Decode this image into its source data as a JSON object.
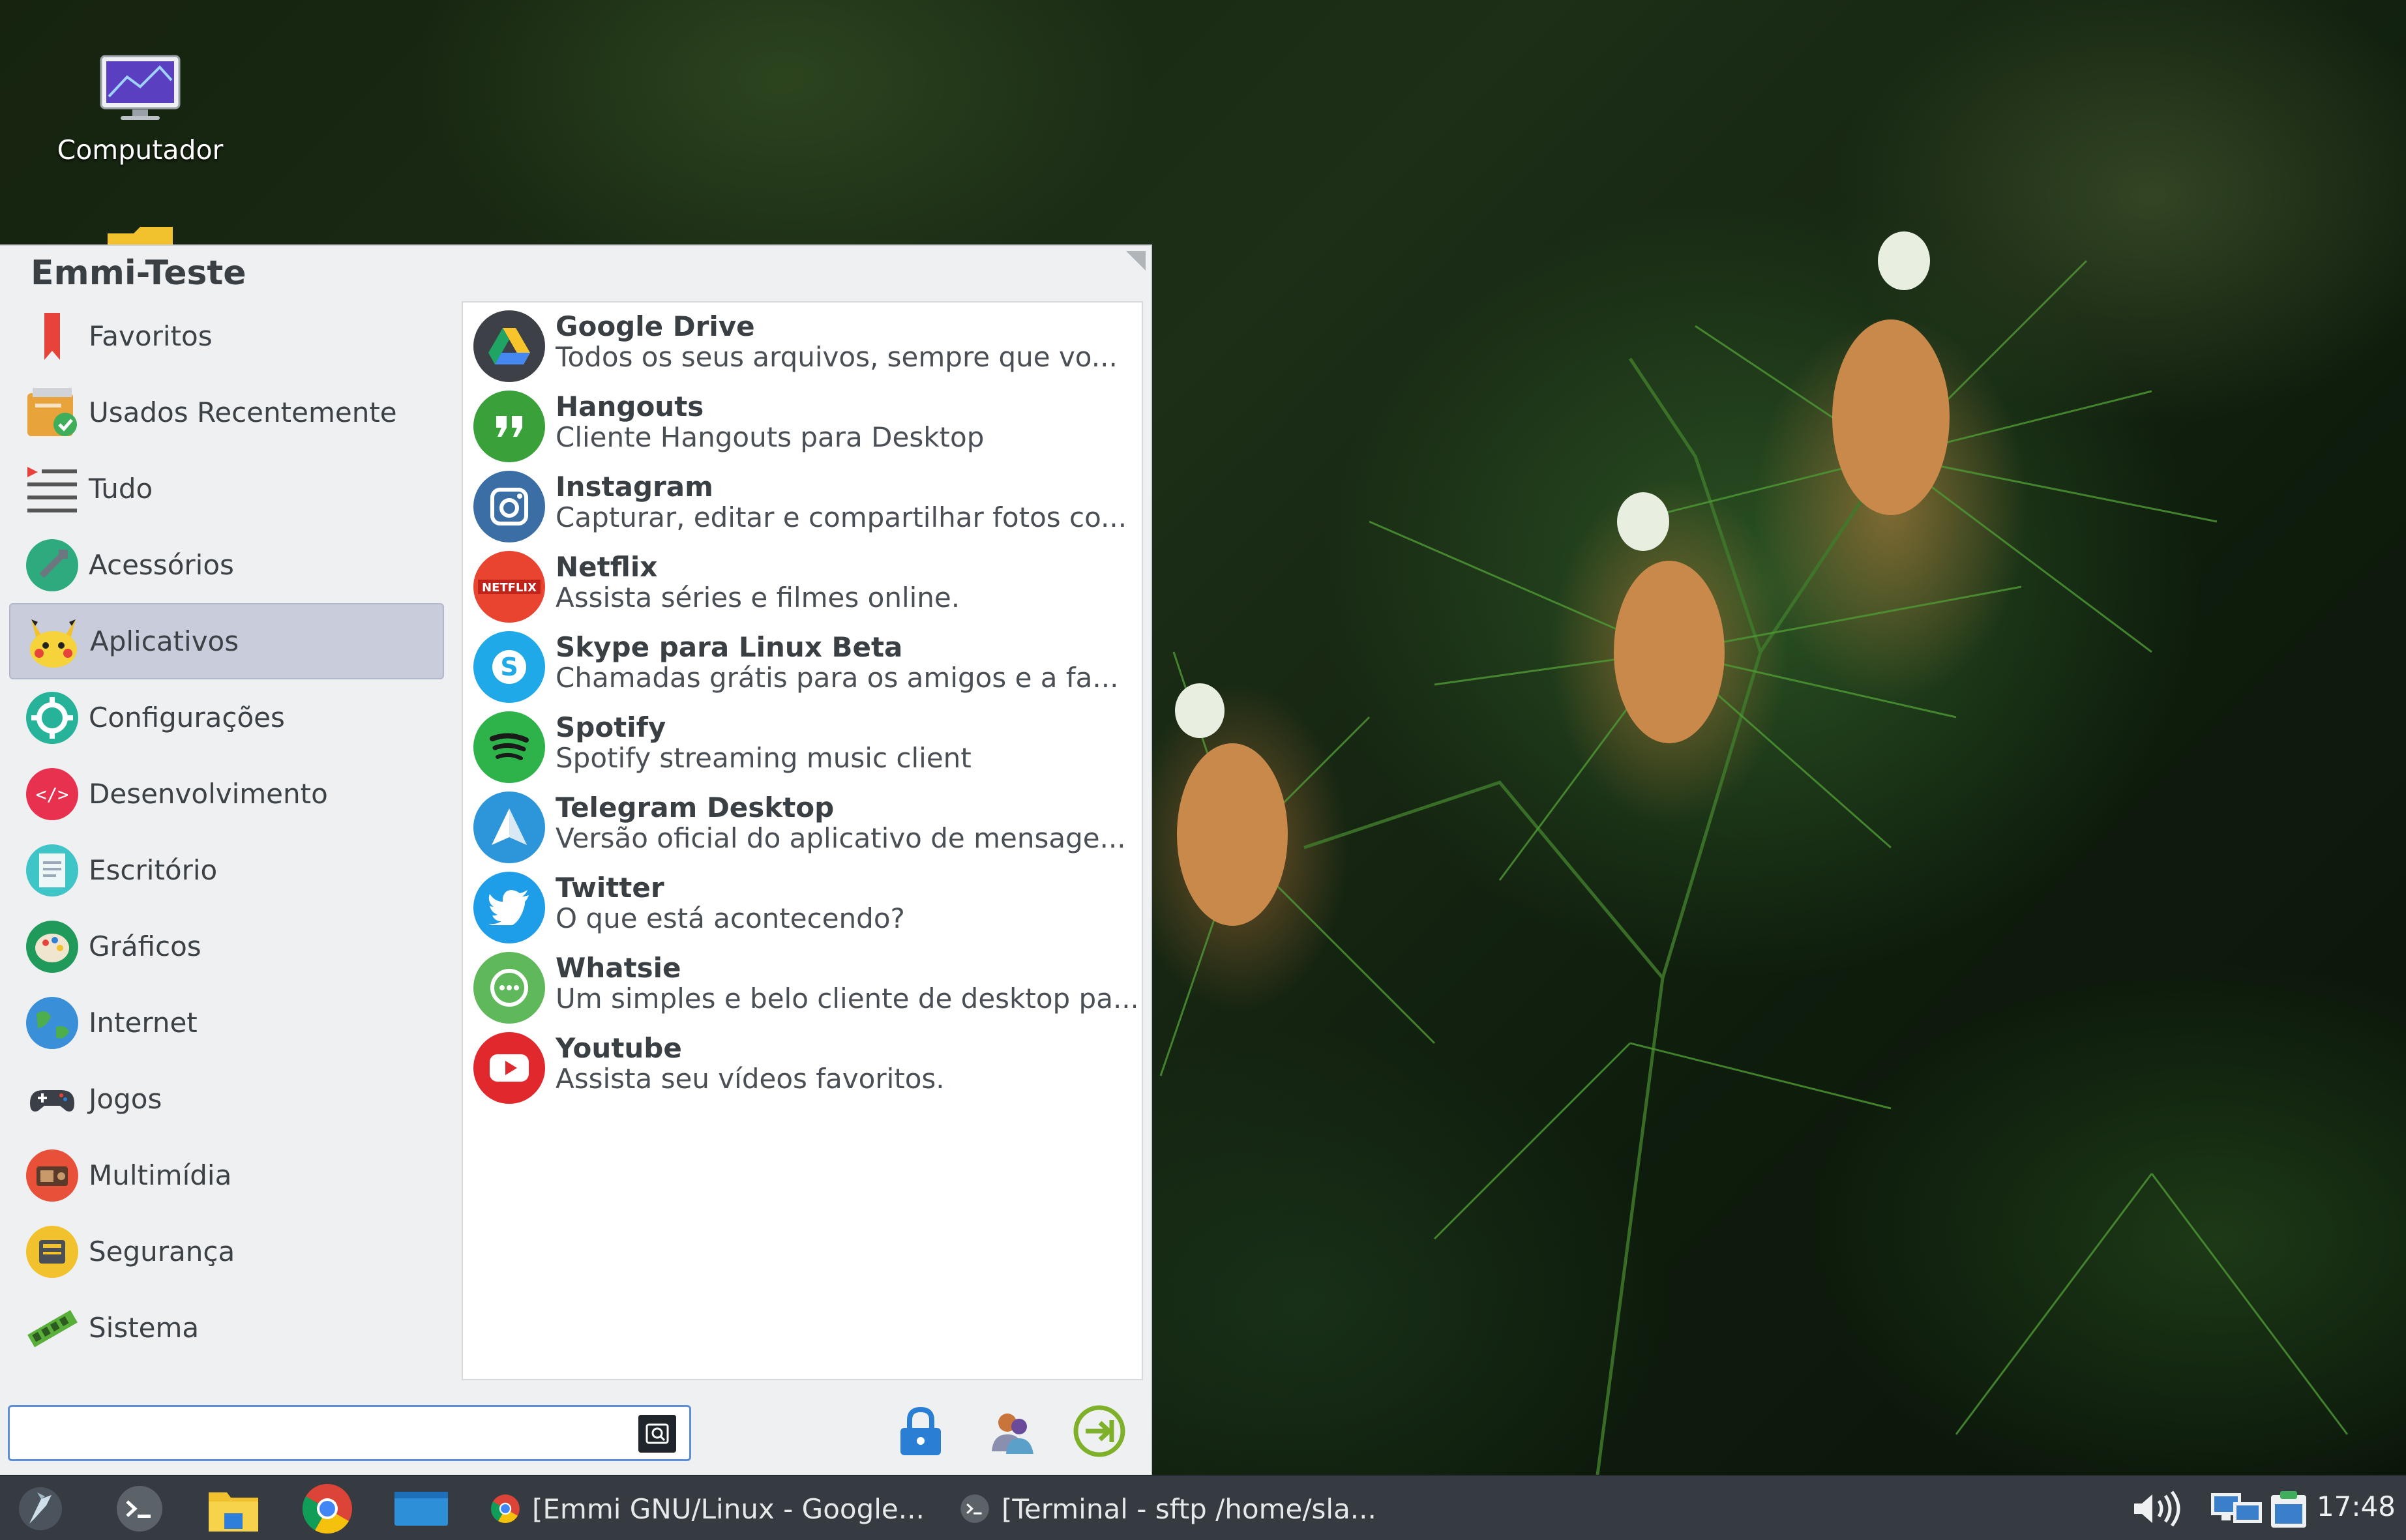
{
  "desktop": {
    "icons": [
      {
        "label": "Computador",
        "icon": "computer-monitor-icon"
      },
      {
        "label": "",
        "icon": "folder-icon"
      }
    ]
  },
  "menu": {
    "user": "Emmi-Teste",
    "categories": [
      {
        "label": "Favoritos",
        "icon": "bookmark-icon"
      },
      {
        "label": "Usados Recentemente",
        "icon": "recent-icon"
      },
      {
        "label": "Tudo",
        "icon": "list-icon"
      },
      {
        "label": "Acessórios",
        "icon": "accessories-icon"
      },
      {
        "label": "Aplicativos",
        "icon": "pikachu-icon",
        "active": true
      },
      {
        "label": "Configurações",
        "icon": "gear-icon"
      },
      {
        "label": "Desenvolvimento",
        "icon": "code-icon"
      },
      {
        "label": "Escritório",
        "icon": "office-icon"
      },
      {
        "label": "Gráficos",
        "icon": "palette-icon"
      },
      {
        "label": "Internet",
        "icon": "globe-icon"
      },
      {
        "label": "Jogos",
        "icon": "gamepad-icon"
      },
      {
        "label": "Multimídia",
        "icon": "radio-icon"
      },
      {
        "label": "Segurança",
        "icon": "security-icon"
      },
      {
        "label": "Sistema",
        "icon": "memory-icon"
      }
    ],
    "apps": [
      {
        "name": "Google Drive",
        "desc": "Todos os seus arquivos, sempre que vo...",
        "icon": "google-drive-icon",
        "color": "#3d4046"
      },
      {
        "name": "Hangouts",
        "desc": "Cliente Hangouts para Desktop",
        "icon": "hangouts-icon",
        "color": "#3aa13a"
      },
      {
        "name": "Instagram",
        "desc": "Capturar, editar e compartilhar fotos co...",
        "icon": "instagram-icon",
        "color": "#3b6ea5"
      },
      {
        "name": "Netflix",
        "desc": "Assista séries e filmes online.",
        "icon": "netflix-icon",
        "color": "#e8442f"
      },
      {
        "name": "Skype para Linux Beta",
        "desc": "Chamadas grátis para os amigos e a fa...",
        "icon": "skype-icon",
        "color": "#1fa9e8"
      },
      {
        "name": "Spotify",
        "desc": "Spotify streaming music client",
        "icon": "spotify-icon",
        "color": "#2db34a"
      },
      {
        "name": "Telegram Desktop",
        "desc": "Versão oficial  do aplicativo de mensage...",
        "icon": "telegram-icon",
        "color": "#2d95d9"
      },
      {
        "name": "Twitter",
        "desc": "O que está acontecendo?",
        "icon": "twitter-icon",
        "color": "#1e9de8"
      },
      {
        "name": "Whatsie",
        "desc": "Um simples e belo cliente de desktop pa...",
        "icon": "whatsie-icon",
        "color": "#5fb85a"
      },
      {
        "name": "Youtube",
        "desc": "Assista seu vídeos favoritos.",
        "icon": "youtube-icon",
        "color": "#e1282d"
      }
    ],
    "search": {
      "value": "",
      "placeholder": ""
    },
    "actions": [
      {
        "name": "lock-screen",
        "icon": "lock-icon"
      },
      {
        "name": "switch-user",
        "icon": "switch-user-icon"
      },
      {
        "name": "logout",
        "icon": "logout-icon"
      }
    ]
  },
  "taskbar": {
    "launchers": [
      "menu-icon",
      "terminal-icon",
      "file-manager-icon",
      "chrome-icon",
      "window-icon"
    ],
    "tasks": [
      {
        "label": "[Emmi GNU/Linux - Google...",
        "icon": "chrome-icon"
      },
      {
        "label": "[Terminal - sftp  /home/sla...",
        "icon": "terminal-icon"
      }
    ],
    "clock": "17:48"
  }
}
